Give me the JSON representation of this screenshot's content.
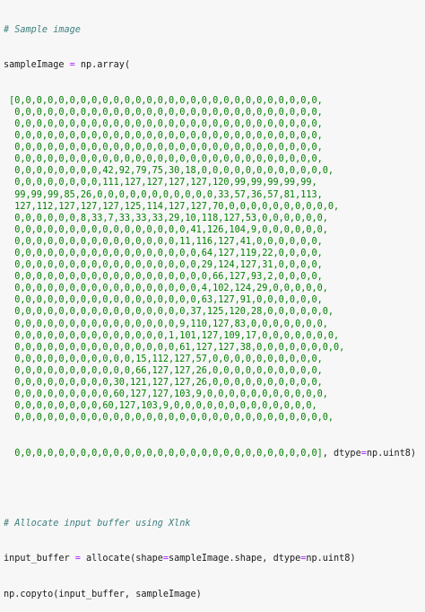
{
  "comment1": "# Sample image",
  "decl": {
    "var": "sampleImage",
    "eq": " = ",
    "call": "np.array("
  },
  "array_rows": [
    " [0,0,0,0,0,0,0,0,0,0,0,0,0,0,0,0,0,0,0,0,0,0,0,0,0,0,0,0,",
    "  0,0,0,0,0,0,0,0,0,0,0,0,0,0,0,0,0,0,0,0,0,0,0,0,0,0,0,0,",
    "  0,0,0,0,0,0,0,0,0,0,0,0,0,0,0,0,0,0,0,0,0,0,0,0,0,0,0,0,",
    "  0,0,0,0,0,0,0,0,0,0,0,0,0,0,0,0,0,0,0,0,0,0,0,0,0,0,0,0,",
    "  0,0,0,0,0,0,0,0,0,0,0,0,0,0,0,0,0,0,0,0,0,0,0,0,0,0,0,0,",
    "  0,0,0,0,0,0,0,0,0,0,0,0,0,0,0,0,0,0,0,0,0,0,0,0,0,0,0,0,",
    "  0,0,0,0,0,0,0,0,42,92,79,75,30,18,0,0,0,0,0,0,0,0,0,0,0,0,",
    "  0,0,0,0,0,0,0,0,111,127,127,127,127,120,99,99,99,99,99,",
    "  99,99,99,85,26,0,0,0,0,0,0,0,0,0,0,0,33,57,36,57,81,113,",
    "  127,112,127,127,127,125,114,127,127,70,0,0,0,0,0,0,0,0,0,0,",
    "  0,0,0,0,0,0,8,33,7,33,33,33,29,10,118,127,53,0,0,0,0,0,0,",
    "  0,0,0,0,0,0,0,0,0,0,0,0,0,0,0,0,41,126,104,9,0,0,0,0,0,0,",
    "  0,0,0,0,0,0,0,0,0,0,0,0,0,0,0,11,116,127,41,0,0,0,0,0,0,",
    "  0,0,0,0,0,0,0,0,0,0,0,0,0,0,0,0,0,64,127,119,22,0,0,0,0,",
    "  0,0,0,0,0,0,0,0,0,0,0,0,0,0,0,0,0,29,124,127,31,0,0,0,0,",
    "  0,0,0,0,0,0,0,0,0,0,0,0,0,0,0,0,0,0,66,127,93,2,0,0,0,0,",
    "  0,0,0,0,0,0,0,0,0,0,0,0,0,0,0,0,0,4,102,124,29,0,0,0,0,0,",
    "  0,0,0,0,0,0,0,0,0,0,0,0,0,0,0,0,0,63,127,91,0,0,0,0,0,0,",
    "  0,0,0,0,0,0,0,0,0,0,0,0,0,0,0,0,37,125,120,28,0,0,0,0,0,0,",
    "  0,0,0,0,0,0,0,0,0,0,0,0,0,0,0,9,110,127,83,0,0,0,0,0,0,0,",
    "  0,0,0,0,0,0,0,0,0,0,0,0,0,0,1,101,127,109,17,0,0,0,0,0,0,0,",
    "  0,0,0,0,0,0,0,0,0,0,0,0,0,0,0,61,127,127,38,0,0,0,0,0,0,0,0,",
    "  0,0,0,0,0,0,0,0,0,0,0,15,112,127,57,0,0,0,0,0,0,0,0,0,0,",
    "  0,0,0,0,0,0,0,0,0,0,0,66,127,127,26,0,0,0,0,0,0,0,0,0,0,",
    "  0,0,0,0,0,0,0,0,0,30,121,127,127,26,0,0,0,0,0,0,0,0,0,0,",
    "  0,0,0,0,0,0,0,0,0,60,127,127,103,9,0,0,0,0,0,0,0,0,0,0,0,",
    "  0,0,0,0,0,0,0,0,60,127,103,9,0,0,0,0,0,0,0,0,0,0,0,0,0,",
    "  0,0,0,0,0,0,0,0,0,0,0,0,0,0,0,0,0,0,0,0,0,0,0,0,0,0,0,0,0,"
  ],
  "last_row": {
    "values": "  0,0,0,0,0,0,0,0,0,0,0,0,0,0,0,0,0,0,0,0,0,0,0,0,0,0,0,0]",
    "sep": ", ",
    "kw": "dtype",
    "eq": "=",
    "dtype": "np.uint8",
    "close": ")"
  },
  "comment2": "# Allocate input buffer using Xlnk",
  "alloc": {
    "var": "input_buffer",
    "eq": " = ",
    "fn": "allocate(shape",
    "eq2": "=",
    "arg": "sampleImage.shape, dtype",
    "eq3": "=",
    "dtype": "np.uint8)"
  },
  "copy": "np.copyto(input_buffer, sampleImage)"
}
